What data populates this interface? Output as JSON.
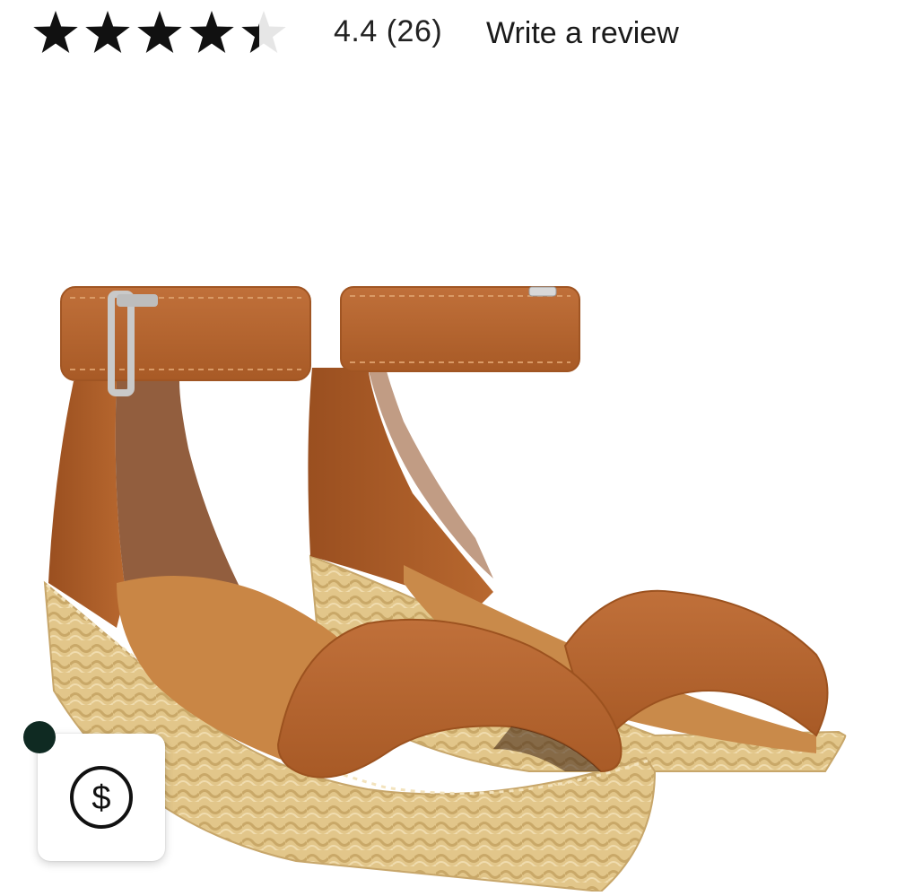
{
  "rating": {
    "value": 4.4,
    "value_text": "4.4",
    "count_text": "(26)",
    "max_stars": 5,
    "write_review_label": "Write a review",
    "star_color": "#111111",
    "empty_star_color": "#e6e6e6"
  },
  "product": {
    "image_icon": "sandal-product-image",
    "leather_color": "#b4632e",
    "jute_color": "#e4c98c"
  },
  "price_alert": {
    "icon": "dollar-circle-icon",
    "icon_color": "#111111",
    "dot_color": "#0f2a22"
  }
}
